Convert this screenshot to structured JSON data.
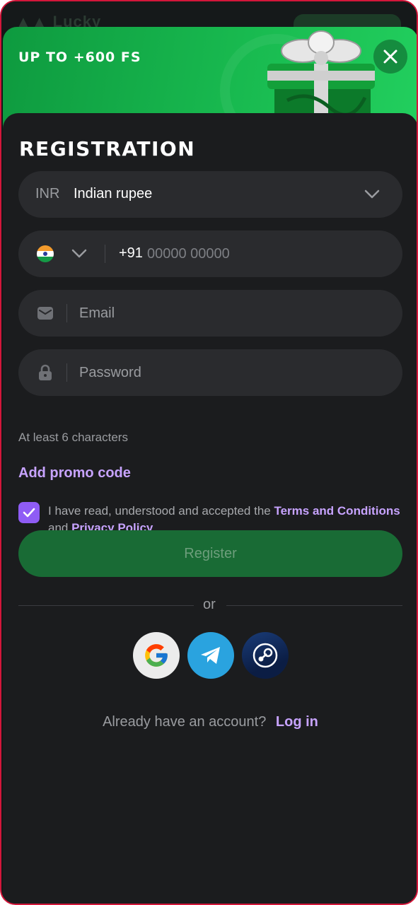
{
  "banner": {
    "title": "UP TO +600 FS"
  },
  "form": {
    "title": "REGISTRATION",
    "currency": {
      "code": "INR",
      "name": "Indian rupee"
    },
    "phone": {
      "code": "+91",
      "placeholder": "00000 00000"
    },
    "email": {
      "placeholder": "Email"
    },
    "password": {
      "placeholder": "Password",
      "hint": "At least 6 characters"
    },
    "promo_label": "Add promo code",
    "agreement": {
      "checked": true,
      "prefix": "I have read, understood and accepted the ",
      "terms_link": "Terms and Conditions",
      "middle": " and ",
      "privacy_link": "Privacy Policy"
    },
    "register_label": "Register",
    "or_label": "or",
    "social": [
      {
        "icon": "google-icon"
      },
      {
        "icon": "telegram-icon"
      },
      {
        "icon": "steam-icon"
      }
    ],
    "login_question": "Already have an account?",
    "login_link": "Log in"
  },
  "colors": {
    "accent_purple": "#8f5cf5",
    "link_purple": "#c7a3ff",
    "banner_green": "#18b94f",
    "register_green": "#196b35",
    "frame_red": "#d3163a"
  }
}
